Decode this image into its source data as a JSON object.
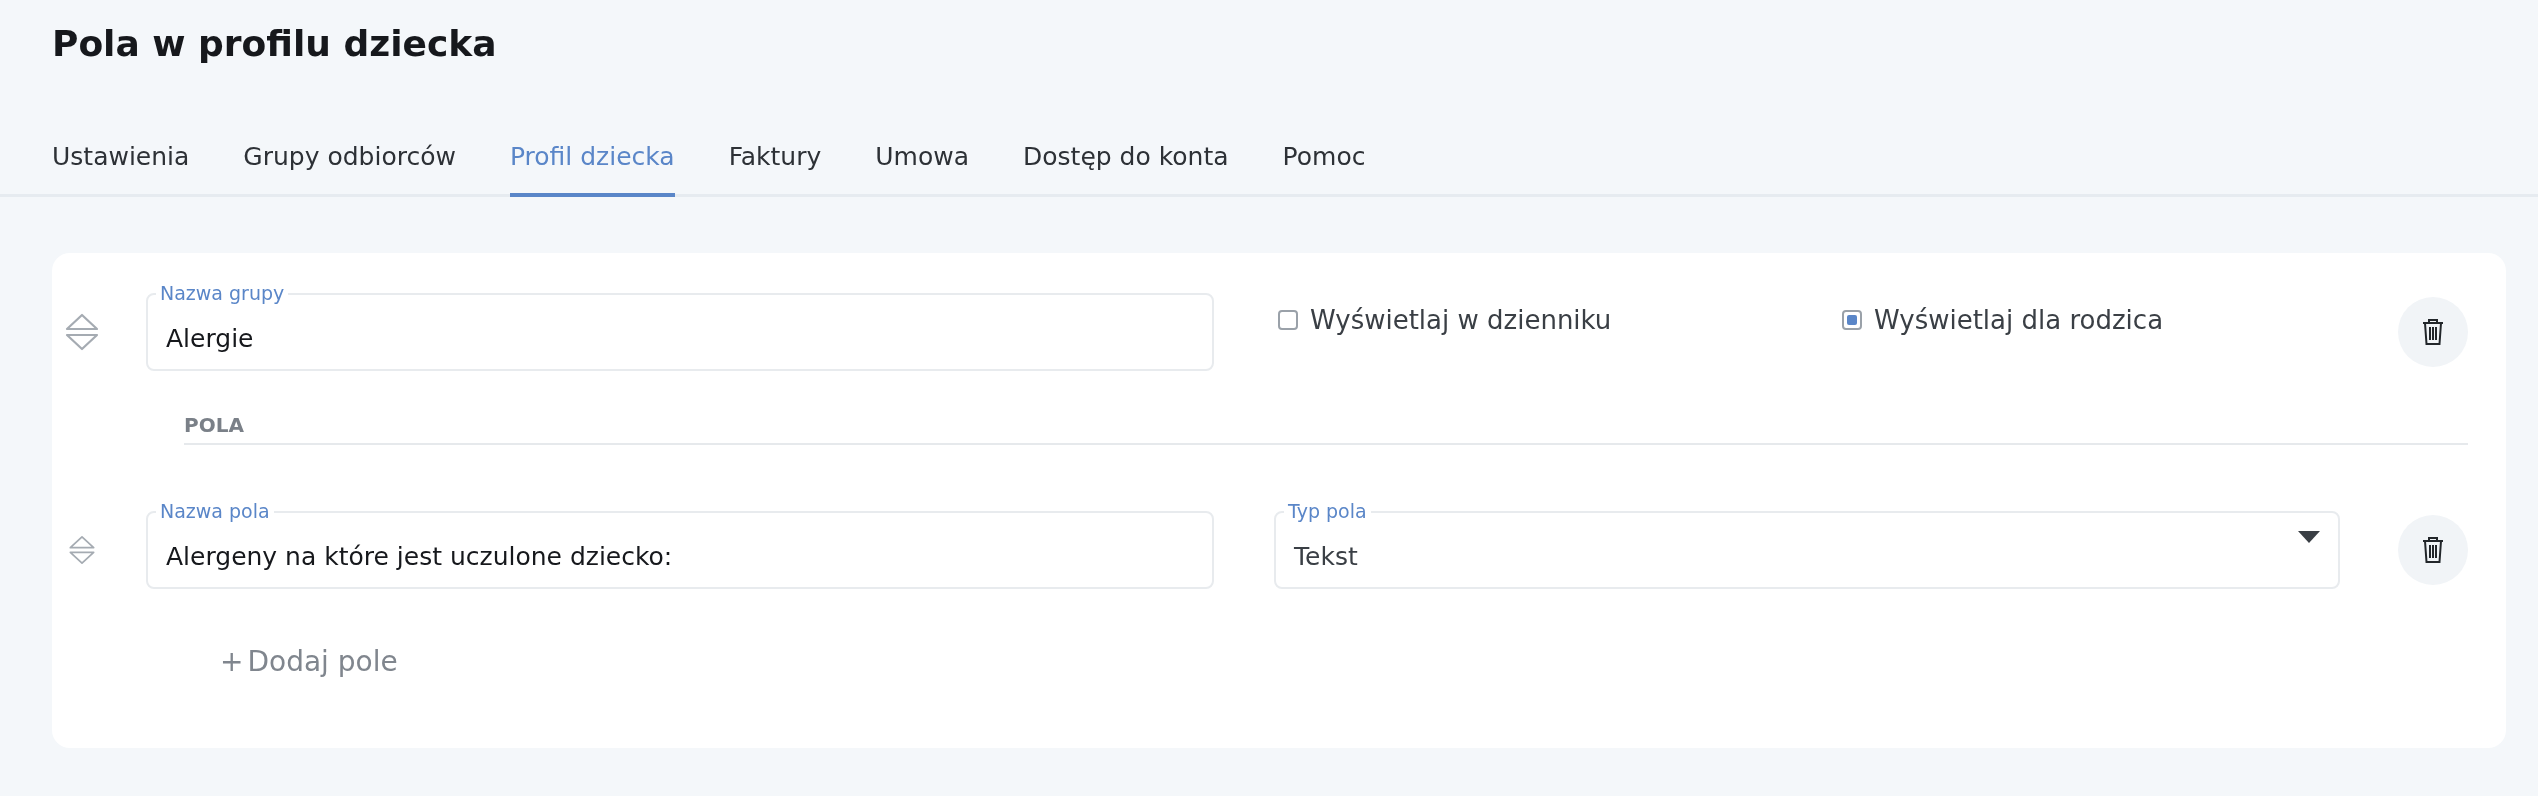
{
  "page_title": "Pola w profilu dziecka",
  "tabs": [
    {
      "label": "Ustawienia",
      "selected": false
    },
    {
      "label": "Grupy odbiorców",
      "selected": false
    },
    {
      "label": "Profil dziecka",
      "selected": true
    },
    {
      "label": "Faktury",
      "selected": false
    },
    {
      "label": "Umowa",
      "selected": false
    },
    {
      "label": "Dostęp do konta",
      "selected": false
    },
    {
      "label": "Pomoc",
      "selected": false
    }
  ],
  "group": {
    "name_label": "Nazwa grupy",
    "name_value": "Alergie",
    "options": [
      {
        "label": "Wyświetlaj w dzienniku",
        "checked": false
      },
      {
        "label": "Wyświetlaj dla rodzica",
        "checked": true
      }
    ],
    "fields_heading": "POLA",
    "fields": [
      {
        "name_label": "Nazwa pola",
        "name_value": "Alergeny na które jest uczulone dziecko:",
        "type_label": "Typ pola",
        "type_value": "Tekst"
      }
    ],
    "add_field": {
      "icon": "+",
      "label": "Dodaj pole"
    }
  }
}
